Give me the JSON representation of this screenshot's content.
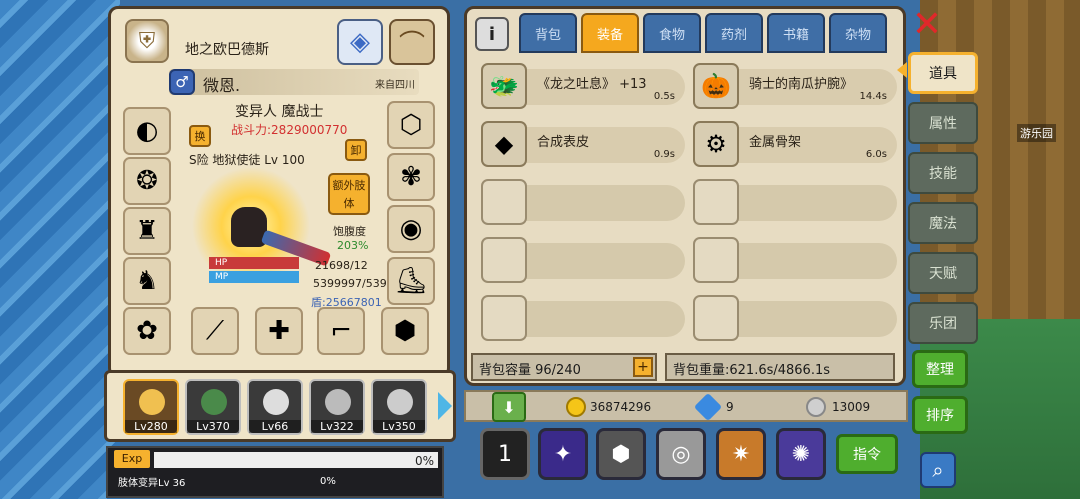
{
  "character": {
    "guild_name": "地之欧巴德斯",
    "player_name": "微恩.",
    "origin": "来自四川",
    "class_title": "变异人 魔战士",
    "combat_power": "战斗力:2829000770",
    "subtitle": "S险 地狱使徒 Lv 100",
    "swap_label": "换",
    "unequip_label": "卸",
    "extra_body_label": "额外肢体",
    "hunger_label": "饱腹度",
    "hunger_value": "203%",
    "hp_label": "HP",
    "mp_label": "MP",
    "hp_value": "21698/12",
    "mp_value": "5399997/539",
    "shield_value": "盾:25667801",
    "gender_symbol": "♂"
  },
  "pets": [
    {
      "level": "Lv280",
      "active": true
    },
    {
      "level": "Lv370",
      "active": false
    },
    {
      "level": "Lv66",
      "active": false
    },
    {
      "level": "Lv322",
      "active": false
    },
    {
      "level": "Lv350",
      "active": false
    }
  ],
  "exp": {
    "label": "Exp",
    "percent": "0%",
    "job_label": "肢体变异Lv 36",
    "job_percent": "0%"
  },
  "inventory": {
    "tabs": [
      "背包",
      "装备",
      "食物",
      "药剂",
      "书籍",
      "杂物"
    ],
    "active_tab": "装备",
    "items": [
      {
        "name": "《龙之吐息》 +13",
        "weight": "0.5s",
        "icon": "dragon-helmet-icon",
        "glyph": "🐲"
      },
      {
        "name": "骑士的南瓜护腕》",
        "weight": "14.4s",
        "icon": "pumpkin-bracer-icon",
        "glyph": "🎃"
      },
      {
        "name": "合成表皮",
        "weight": "0.9s",
        "icon": "synthetic-skin-icon",
        "glyph": "◆"
      },
      {
        "name": "金属骨架",
        "weight": "6.0s",
        "icon": "metal-frame-icon",
        "glyph": "⚙"
      }
    ],
    "capacity": "背包容量 96/240",
    "weight": "背包重量:621.6s/4866.1s"
  },
  "side_tabs": [
    "道具",
    "属性",
    "技能",
    "魔法",
    "天赋",
    "乐团"
  ],
  "active_side_tab": "道具",
  "side_actions": {
    "sort_label": "整理",
    "order_label": "排序",
    "command_label": "指令"
  },
  "currency": {
    "gold": "36874296",
    "diamond": "9",
    "silver": "13009"
  },
  "map_label": "游乐园",
  "colors": {
    "accent": "#f5a81e",
    "panel": "#e7dcc2",
    "tab_blue": "#3f6ea6",
    "power_red": "#d23030",
    "green": "#4fae2e"
  }
}
